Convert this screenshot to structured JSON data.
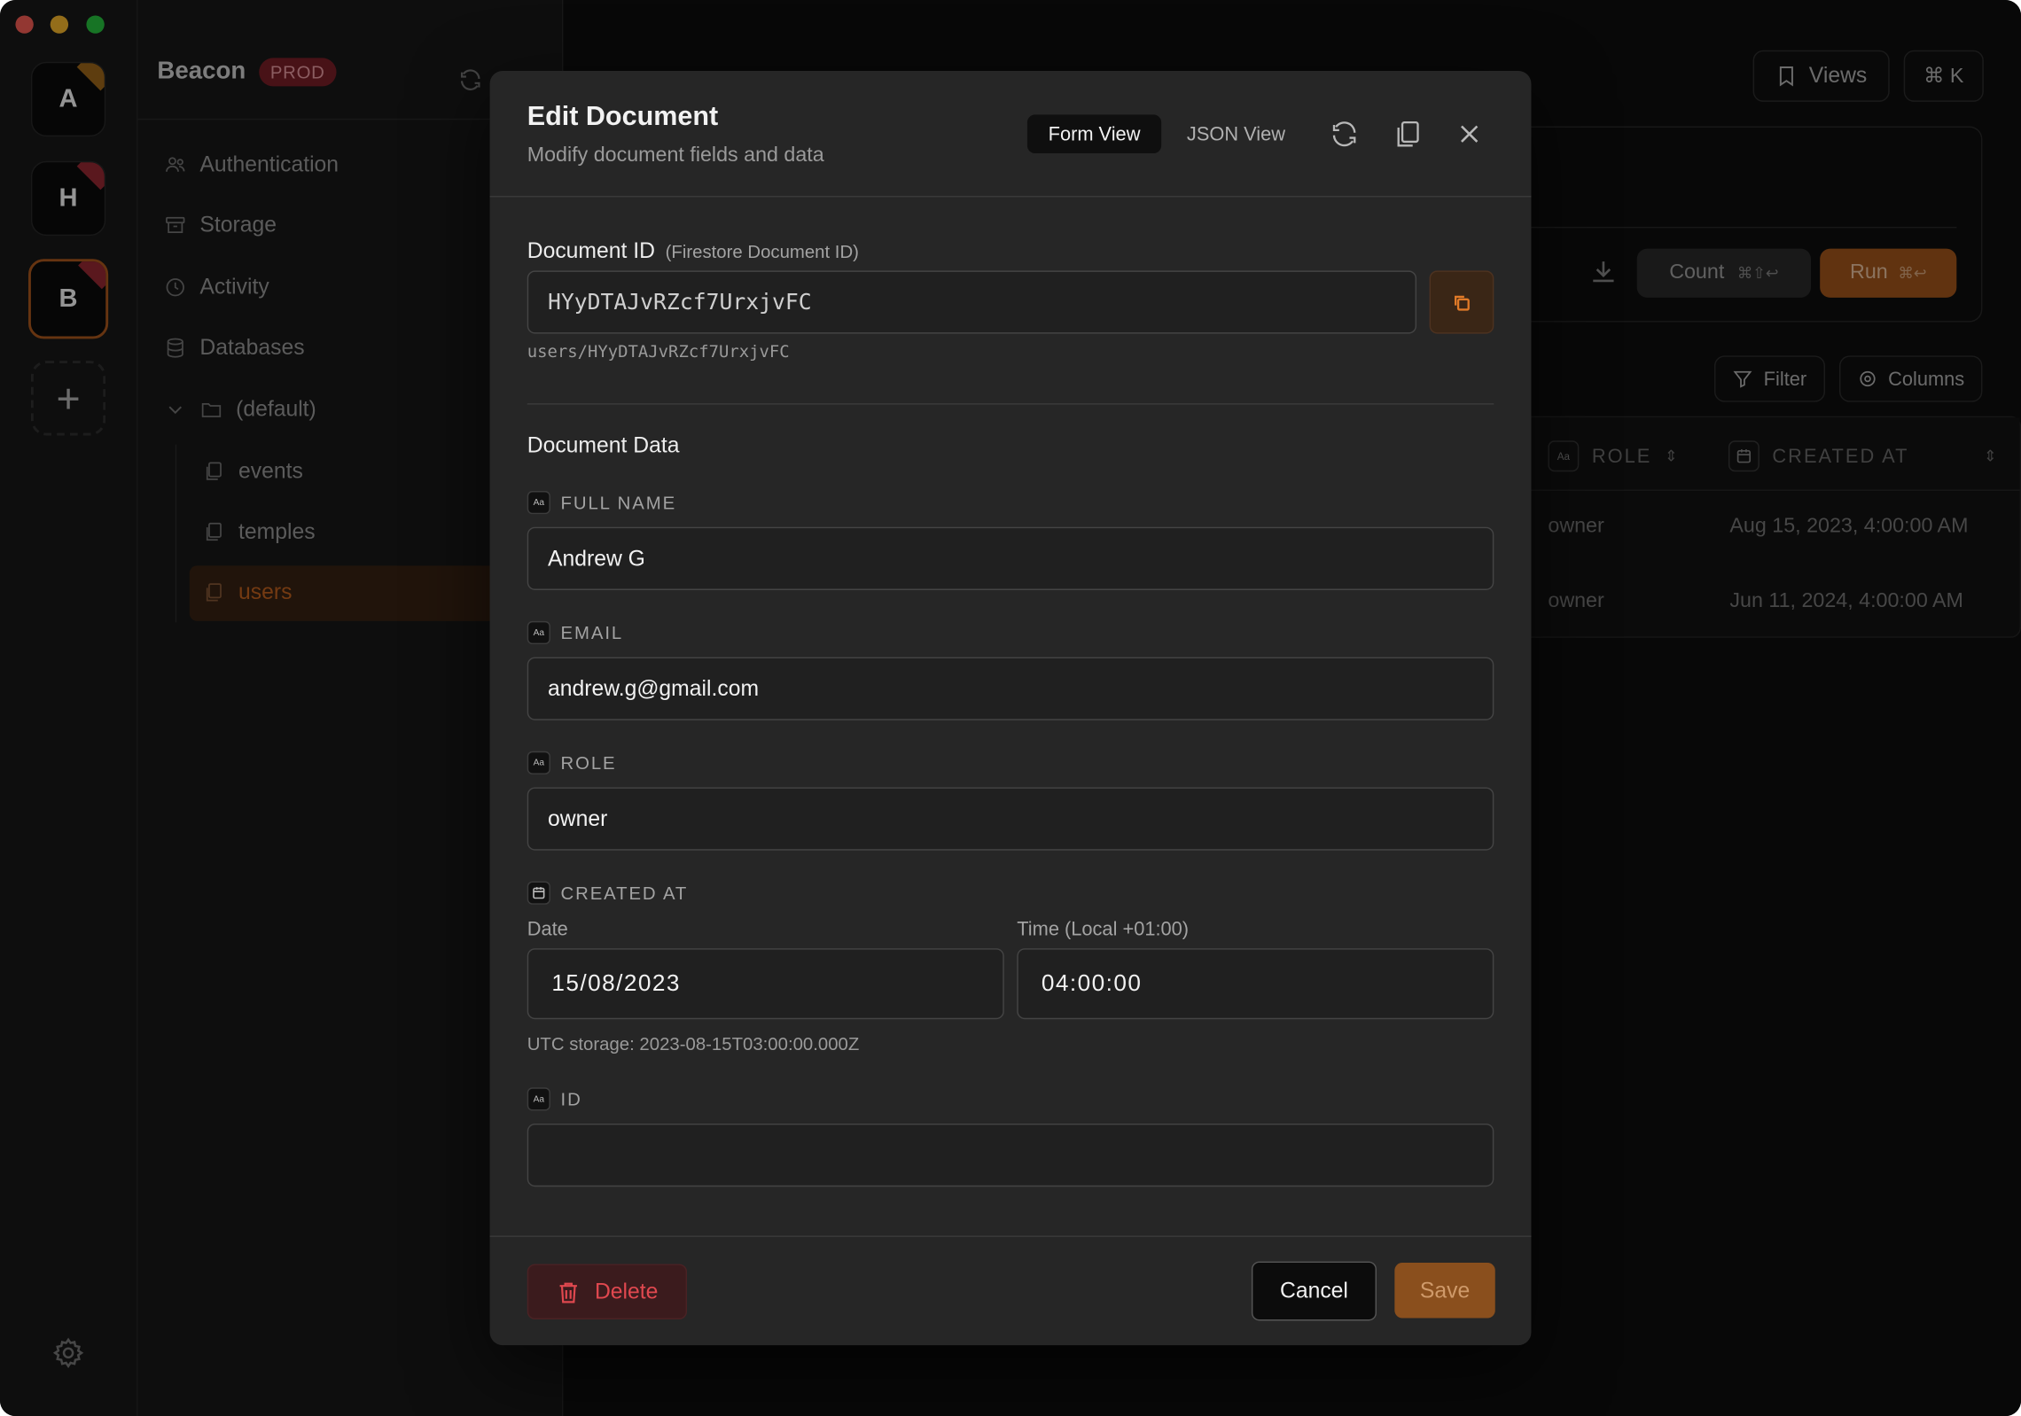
{
  "sidebar": {
    "app_name": "Beacon",
    "env_badge": "PROD",
    "items": [
      {
        "label": "Authentication",
        "icon": "users-icon"
      },
      {
        "label": "Storage",
        "icon": "archive-icon"
      },
      {
        "label": "Activity",
        "icon": "clock-icon"
      },
      {
        "label": "Databases",
        "icon": "database-icon"
      },
      {
        "label": "(default)",
        "icon": "folder-icon"
      },
      {
        "label": "events",
        "icon": "collection-icon"
      },
      {
        "label": "temples",
        "icon": "collection-icon"
      },
      {
        "label": "users",
        "icon": "collection-icon"
      }
    ]
  },
  "workspaces": [
    {
      "letter": "A",
      "color": "#a26a1a"
    },
    {
      "letter": "H",
      "color": "#9b2a35"
    },
    {
      "letter": "B",
      "color": "#9b2a35"
    }
  ],
  "toolbar": {
    "views_label": "Views",
    "command_label": "⌘ K",
    "count_label": "Count",
    "count_shortcut": "⌘⇧↩",
    "run_label": "Run",
    "run_shortcut": "⌘↩",
    "filter_label": "Filter",
    "columns_label": "Columns"
  },
  "table": {
    "columns": [
      {
        "label": "ROLE",
        "type": "Aa"
      },
      {
        "label": "CREATED AT",
        "type": "calendar"
      }
    ],
    "rows": [
      {
        "role": "owner",
        "created_at": "Aug 15, 2023, 4:00:00 AM"
      },
      {
        "role": "owner",
        "created_at": "Jun 11, 2024, 4:00:00 AM"
      }
    ]
  },
  "modal": {
    "title": "Edit Document",
    "subtitle": "Modify document fields and data",
    "tab_form": "Form View",
    "tab_json": "JSON View",
    "doc_id_label": "Document ID",
    "doc_id_hint": "(Firestore Document ID)",
    "doc_id_value": "HYyDTAJvRZcf7UrxjvFC",
    "doc_path": "users/HYyDTAJvRZcf7UrxjvFC",
    "data_title": "Document Data",
    "type_chip": "Aa",
    "fields": {
      "full_name": {
        "label": "FULL NAME",
        "value": "Andrew G"
      },
      "email": {
        "label": "EMAIL",
        "value": "andrew.g@gmail.com"
      },
      "role": {
        "label": "ROLE",
        "value": "owner"
      },
      "created_at": {
        "label": "CREATED AT",
        "date_label": "Date",
        "date_value": "15/08/2023",
        "time_label": "Time (Local +01:00)",
        "time_value": "04:00:00",
        "utc_note": "UTC storage: 2023-08-15T03:00:00.000Z"
      },
      "id": {
        "label": "ID",
        "value": ""
      }
    },
    "delete_label": "Delete",
    "cancel_label": "Cancel",
    "save_label": "Save"
  },
  "colors": {
    "accent": "#a8581c",
    "danger": "#e0484f",
    "prod_badge": "#7d1f28"
  }
}
